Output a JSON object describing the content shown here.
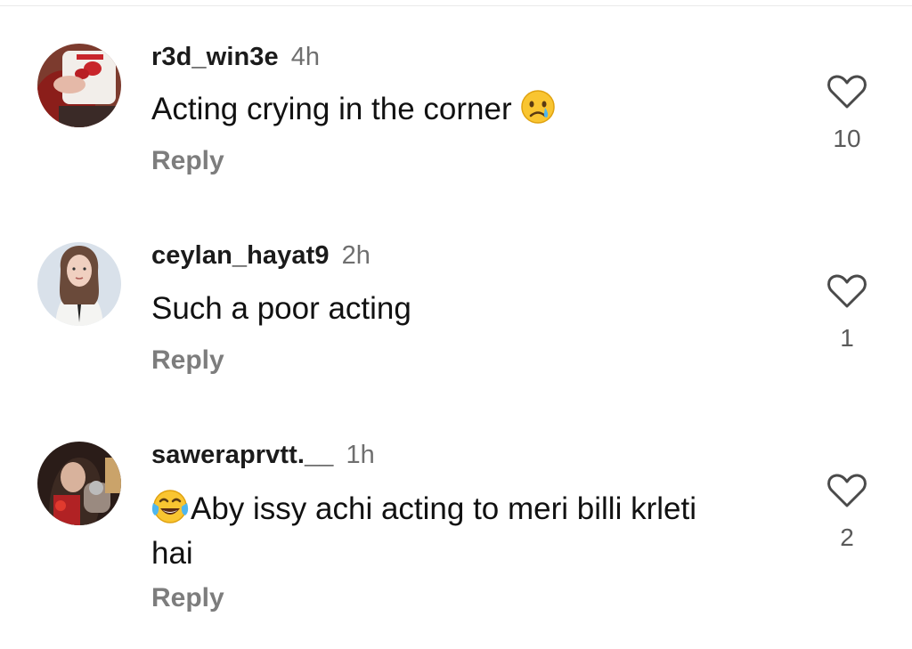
{
  "comments": [
    {
      "username": "r3d_win3e",
      "time": "4h",
      "text": "Acting crying in the corner",
      "emoji": "crying-face-emoji",
      "reply_label": "Reply",
      "likes": "10",
      "like_icon": "heart-outline-icon"
    },
    {
      "username": "ceylan_hayat9",
      "time": "2h",
      "text": "Such a poor acting",
      "reply_label": "Reply",
      "likes": "1",
      "like_icon": "heart-outline-icon"
    },
    {
      "username": "saweraprvtt.__",
      "time": "1h",
      "text_line1": "Aby issy achi acting to meri billi krleti",
      "text_line2": "hai",
      "emoji": "tears-of-joy-emoji",
      "reply_label": "Reply",
      "likes": "2",
      "like_icon": "heart-outline-icon"
    }
  ],
  "colors": {
    "username": "#1b1b1b",
    "timestamp": "#6f6f6f",
    "reply": "#7d7d7d",
    "like_count": "#5a5a5a"
  }
}
